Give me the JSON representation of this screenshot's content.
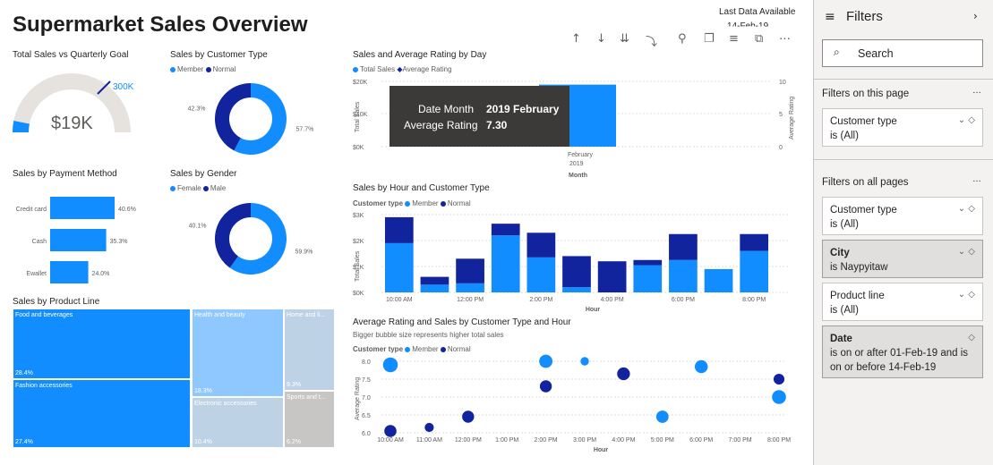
{
  "header": {
    "title": "Supermarket Sales Overview",
    "last_data_label": "Last Data Available",
    "last_data_date": "14-Feb-19"
  },
  "gauge": {
    "title": "Total Sales vs Quarterly Goal",
    "value_label": "$19K",
    "target_label": "300K",
    "fraction": 0.063
  },
  "customer_type": {
    "title": "Sales by Customer Type",
    "legend": [
      "Member",
      "Normal"
    ],
    "chart_data": {
      "type": "pie",
      "labels": [
        "Member",
        "Normal"
      ],
      "values": [
        57.7,
        42.3
      ],
      "value_labels": [
        "57.7%",
        "42.3%"
      ]
    }
  },
  "payment": {
    "title": "Sales by Payment Method",
    "chart_data": {
      "type": "bar",
      "categories": [
        "Credit card",
        "Cash",
        "Ewallet"
      ],
      "values": [
        40.6,
        35.3,
        24.0
      ],
      "value_labels": [
        "40.6%",
        "35.3%",
        "24.0%"
      ]
    }
  },
  "gender": {
    "title": "Sales by Gender",
    "legend": [
      "Female",
      "Male"
    ],
    "chart_data": {
      "type": "pie",
      "labels": [
        "Female",
        "Male"
      ],
      "values": [
        59.9,
        40.1
      ],
      "value_labels": [
        "59.9%",
        "40.1%"
      ]
    }
  },
  "product_line": {
    "title": "Sales by Product Line",
    "items": [
      {
        "name": "Food and beverages",
        "pct": "28.4%"
      },
      {
        "name": "Fashion accessories",
        "pct": "27.4%"
      },
      {
        "name": "Health and beauty",
        "pct": "18.3%"
      },
      {
        "name": "Electronic accessories",
        "pct": "10.4%"
      },
      {
        "name": "Home and li...",
        "pct": "9.3%"
      },
      {
        "name": "Sports and t...",
        "pct": "6.2%"
      }
    ]
  },
  "sales_rating_day": {
    "title": "Sales and Average Rating by Day",
    "legend": [
      "Total Sales",
      "Average Rating"
    ],
    "x_tick": "February",
    "x_tick2": "2019",
    "xlabel": "Month",
    "ylabel": "Total Sales",
    "y2label": "Average Rating",
    "y_ticks": [
      "$20K",
      "$10K",
      "$0K"
    ],
    "y2_ticks": [
      "10",
      "5",
      "0"
    ],
    "chart_data": {
      "type": "bar",
      "categories": [
        "2019 February"
      ],
      "series": [
        {
          "name": "Total Sales",
          "values": [
            19000
          ]
        },
        {
          "name": "Average Rating",
          "values": [
            7.3
          ]
        }
      ],
      "ylim": [
        0,
        20000
      ]
    },
    "tooltip": {
      "k1": "Date Month",
      "v1": "2019 February",
      "k2": "Average Rating",
      "v2": "7.30"
    }
  },
  "sales_hour": {
    "title": "Sales by Hour and Customer Type",
    "legend_label": "Customer type",
    "legend": [
      "Member",
      "Normal"
    ],
    "xlabel": "Hour",
    "ylabel": "Total Sales",
    "y_ticks": [
      "$3K",
      "$2K",
      "$1K",
      "$0K"
    ],
    "x_ticks": [
      "10:00 AM",
      "12:00 PM",
      "2:00 PM",
      "4:00 PM",
      "6:00 PM",
      "8:00 PM"
    ],
    "chart_data": {
      "type": "bar",
      "stacked": true,
      "categories": [
        "10",
        "11",
        "12",
        "13",
        "14",
        "15",
        "16",
        "17",
        "18",
        "19",
        "20"
      ],
      "ylim": [
        0,
        3000
      ],
      "series": [
        {
          "name": "Member",
          "values": [
            1900,
            300,
            350,
            2200,
            1350,
            200,
            0,
            1050,
            1250,
            900,
            1600
          ]
        },
        {
          "name": "Normal",
          "values": [
            1000,
            300,
            950,
            450,
            950,
            1200,
            1200,
            200,
            1000,
            0,
            650
          ]
        }
      ]
    }
  },
  "rating_hour": {
    "title": "Average Rating and Sales by Customer Type and Hour",
    "subtitle": "Bigger bubble size represents higher total sales",
    "legend_label": "Customer type",
    "legend": [
      "Member",
      "Normal"
    ],
    "xlabel": "Hour",
    "ylabel": "Average Rating",
    "y_ticks": [
      "8.0",
      "7.5",
      "7.0",
      "6.5",
      "6.0"
    ],
    "x_ticks": [
      "10:00 AM",
      "11:00 AM",
      "12:00 PM",
      "1:00 PM",
      "2:00 PM",
      "3:00 PM",
      "4:00 PM",
      "5:00 PM",
      "6:00 PM",
      "7:00 PM",
      "8:00 PM"
    ],
    "chart_data": {
      "type": "scatter",
      "ylim": [
        6.0,
        8.0
      ],
      "series": [
        {
          "name": "Member",
          "points": [
            {
              "x": 10,
              "y": 7.9,
              "size": 1900
            },
            {
              "x": 14,
              "y": 8.0,
              "size": 1350
            },
            {
              "x": 15,
              "y": 8.0,
              "size": 200
            },
            {
              "x": 17,
              "y": 6.45,
              "size": 1050
            },
            {
              "x": 18,
              "y": 7.85,
              "size": 1250
            },
            {
              "x": 20,
              "y": 7.0,
              "size": 1600
            }
          ]
        },
        {
          "name": "Normal",
          "points": [
            {
              "x": 10,
              "y": 6.05,
              "size": 1000
            },
            {
              "x": 11,
              "y": 6.15,
              "size": 300
            },
            {
              "x": 12,
              "y": 6.45,
              "size": 950
            },
            {
              "x": 14,
              "y": 7.3,
              "size": 950
            },
            {
              "x": 16,
              "y": 7.65,
              "size": 1200
            },
            {
              "x": 20,
              "y": 7.5,
              "size": 650
            }
          ]
        }
      ]
    }
  },
  "filters": {
    "title": "Filters",
    "search_placeholder": "Search",
    "on_page_label": "Filters on this page",
    "all_pages_label": "Filters on all pages",
    "page_filters": [
      {
        "name": "Customer type",
        "value": "is (All)"
      }
    ],
    "all_filters": [
      {
        "name": "Customer type",
        "value": "is (All)"
      },
      {
        "name": "City",
        "value": "is Naypyitaw"
      },
      {
        "name": "Product line",
        "value": "is (All)"
      },
      {
        "name": "Date",
        "value": "is on or after 01-Feb-19 and is on or before 14-Feb-19"
      }
    ]
  },
  "colors": {
    "member": "#118dff",
    "normal": "#12239e",
    "gauge_bg": "#e6e3df",
    "light": "#8fc7ff",
    "lighter": "#bed2e6",
    "gray": "#c8c6c4"
  }
}
